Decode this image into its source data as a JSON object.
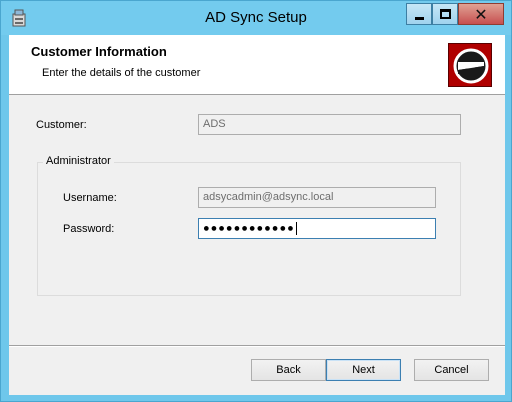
{
  "window": {
    "title": "AD Sync Setup",
    "controls": {
      "minimize": "minimize-icon",
      "maximize": "maximize-icon",
      "close": "close-icon"
    }
  },
  "banner": {
    "title": "Customer Information",
    "description": "Enter the details of the customer",
    "logo": "disc-logo-icon"
  },
  "form": {
    "customer_label": "Customer:",
    "customer_value": "ADS",
    "group_title": "Administrator",
    "username_label": "Username:",
    "username_value": "adsycadmin@adsync.local",
    "password_label": "Password:",
    "password_mask": "●●●●●●●●●●●●"
  },
  "buttons": {
    "back": "Back",
    "next": "Next",
    "cancel": "Cancel"
  },
  "colors": {
    "titlebar": "#73cbee",
    "close_button": "#c75050",
    "logo_background": "#b00000",
    "focus_border": "#3c7fb1"
  }
}
